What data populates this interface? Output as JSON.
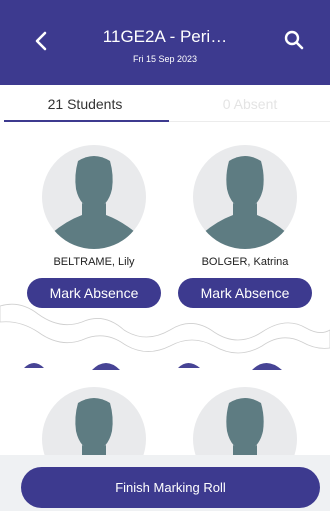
{
  "header": {
    "title": "11GE2A - Peri…",
    "date": "Fri 15 Sep 2023",
    "back_icon": "back-chevron-icon",
    "search_icon": "search-icon",
    "background_color": "#3d3a8f"
  },
  "tabs": [
    {
      "label": "21 Students",
      "selected": true
    },
    {
      "label": "0 Absent",
      "selected": false
    }
  ],
  "students": [
    {
      "name": "BELTRAME, Lily",
      "action_label": "Mark Absence",
      "avatar_icon": "person-silhouette-icon"
    },
    {
      "name": "BOLGER, Katrina",
      "action_label": "Mark Absence",
      "avatar_icon": "person-silhouette-icon"
    }
  ],
  "footer": {
    "finish_label": "Finish Marking Roll"
  },
  "colors": {
    "accent": "#3d3a8f",
    "avatar_fill": "#5e7c82",
    "avatar_background": "#e9eaec"
  }
}
